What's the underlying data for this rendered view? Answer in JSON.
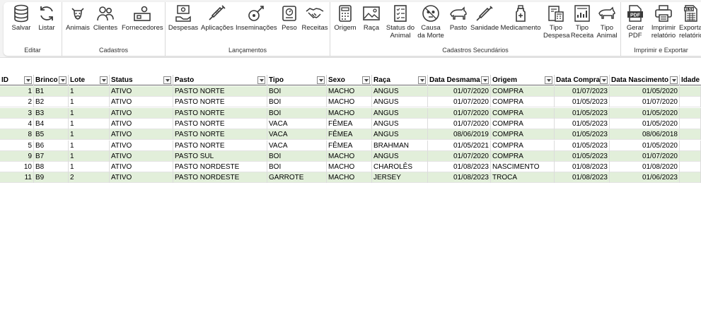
{
  "ribbon": {
    "groups": [
      {
        "label": "Editar",
        "buttons": [
          {
            "label": "Salvar",
            "icon": "database-icon"
          },
          {
            "label": "Listar",
            "icon": "refresh-icon"
          }
        ]
      },
      {
        "label": "Cadastros",
        "buttons": [
          {
            "label": "Animais",
            "icon": "cow-icon"
          },
          {
            "label": "Clientes",
            "icon": "users-icon"
          },
          {
            "label": "Fornecedores",
            "icon": "supplier-icon"
          }
        ]
      },
      {
        "label": "Lançamentos",
        "buttons": [
          {
            "label": "Despesas",
            "icon": "money-icon"
          },
          {
            "label": "Aplicações",
            "icon": "syringe-icon"
          },
          {
            "label": "Inseminações",
            "icon": "insemination-icon"
          },
          {
            "label": "Peso",
            "icon": "scale-icon"
          },
          {
            "label": "Receitas",
            "icon": "handshake-icon"
          }
        ]
      },
      {
        "label": "Cadastros Secundários",
        "buttons": [
          {
            "label": "Origem",
            "icon": "calculator-icon"
          },
          {
            "label": "Raça",
            "icon": "picture-icon"
          },
          {
            "label": "Status do\nAnimal",
            "icon": "checklist-icon"
          },
          {
            "label": "Causa\nda Morte",
            "icon": "skull-icon"
          },
          {
            "label": "Pasto",
            "icon": "bull-icon"
          },
          {
            "label": "Sanidade",
            "icon": "syringe2-icon"
          },
          {
            "label": "Medicamento",
            "icon": "bottle-icon"
          },
          {
            "label": "Tipo\nDespesa",
            "icon": "calc-doc-icon"
          },
          {
            "label": "Tipo\nReceita",
            "icon": "chart-doc-icon"
          },
          {
            "label": "Tipo\nAnimal",
            "icon": "animal-icon"
          }
        ]
      },
      {
        "label": "Imprimir e Exportar",
        "buttons": [
          {
            "label": "Gerar\nPDF",
            "icon": "pdf-icon"
          },
          {
            "label": "Imprimir\nrelatório",
            "icon": "printer-icon"
          },
          {
            "label": "Exportar\nrelatório",
            "icon": "xlsx-icon"
          }
        ]
      }
    ]
  },
  "table": {
    "columns": [
      "ID",
      "Brinco",
      "Lote",
      "Status",
      "Pasto",
      "Tipo",
      "Sexo",
      "Raça",
      "Data Desmama",
      "Origem",
      "Data Compra",
      "Data Nascimento",
      "Idade"
    ],
    "rows": [
      [
        "1",
        "B1",
        "1",
        "ATIVO",
        "PASTO NORTE",
        "BOI",
        "MACHO",
        "ANGUS",
        "01/07/2020",
        "COMPRA",
        "01/07/2023",
        "01/05/2020",
        ""
      ],
      [
        "2",
        "B2",
        "1",
        "ATIVO",
        "PASTO NORTE",
        "BOI",
        "MACHO",
        "ANGUS",
        "01/07/2020",
        "COMPRA",
        "01/05/2023",
        "01/07/2020",
        ""
      ],
      [
        "3",
        "B3",
        "1",
        "ATIVO",
        "PASTO NORTE",
        "BOI",
        "MACHO",
        "ANGUS",
        "01/07/2020",
        "COMPRA",
        "01/05/2023",
        "01/05/2020",
        ""
      ],
      [
        "4",
        "B4",
        "1",
        "ATIVO",
        "PASTO NORTE",
        "VACA",
        "FÊMEA",
        "ANGUS",
        "01/07/2020",
        "COMPRA",
        "01/05/2023",
        "01/05/2020",
        ""
      ],
      [
        "8",
        "B5",
        "1",
        "ATIVO",
        "PASTO NORTE",
        "VACA",
        "FÊMEA",
        "ANGUS",
        "08/06/2019",
        "COMPRA",
        "01/05/2023",
        "08/06/2018",
        ""
      ],
      [
        "5",
        "B6",
        "1",
        "ATIVO",
        "PASTO NORTE",
        "VACA",
        "FÊMEA",
        "BRAHMAN",
        "01/05/2021",
        "COMPRA",
        "01/05/2023",
        "01/05/2020",
        ""
      ],
      [
        "9",
        "B7",
        "1",
        "ATIVO",
        "PASTO SUL",
        "BOI",
        "MACHO",
        "ANGUS",
        "01/07/2020",
        "COMPRA",
        "01/05/2023",
        "01/07/2020",
        ""
      ],
      [
        "10",
        "B8",
        "1",
        "ATIVO",
        "PASTO NORDESTE",
        "BOI",
        "MACHO",
        "CHAROLÊS",
        "01/08/2023",
        "NASCIMENTO",
        "01/08/2023",
        "01/08/2020",
        ""
      ],
      [
        "11",
        "B9",
        "2",
        "ATIVO",
        "PASTO NORDESTE",
        "GARROTE",
        "MACHO",
        "JERSEY",
        "01/08/2023",
        "TROCA",
        "01/08/2023",
        "01/06/2023",
        ""
      ]
    ]
  },
  "colors": {
    "band": "#e2efda",
    "icon": "#3a3a3a"
  }
}
